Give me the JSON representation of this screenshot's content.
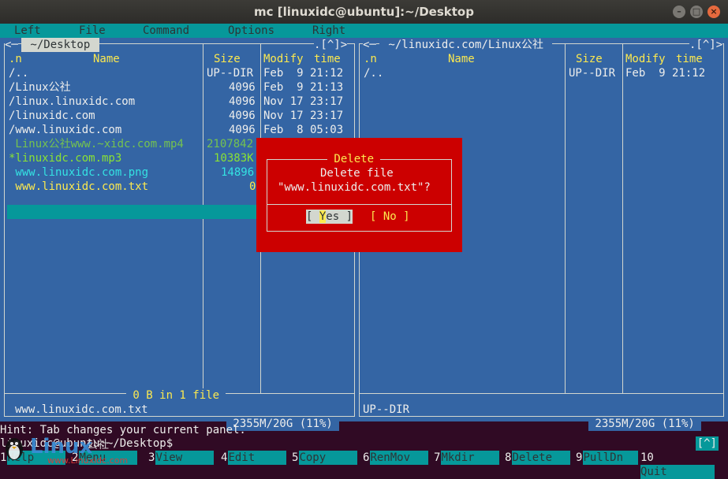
{
  "window": {
    "title": "mc [linuxidc@ubuntu]:~/Desktop"
  },
  "menu": {
    "left": "Left",
    "file": "File",
    "command": "Command",
    "options": "Options",
    "right": "Right"
  },
  "left_panel": {
    "path": " ~/Desktop ",
    "corner": ".[^]>",
    "cols": {
      "n": ".n",
      "name": "Name",
      "size": "Size",
      "modify": "Modify",
      "time": "time"
    },
    "rows": [
      {
        "name": "/..",
        "size": "UP--DIR",
        "date": "Feb  9 21:12"
      },
      {
        "name": "/Linux公社",
        "size": "4096",
        "date": "Feb  9 21:13"
      },
      {
        "name": "/linux.linuxidc.com",
        "size": "4096",
        "date": "Nov 17 23:17"
      },
      {
        "name": "/linuxidc.com",
        "size": "4096",
        "date": "Nov 17 23:17"
      },
      {
        "name": "/www.linuxidc.com",
        "size": "4096",
        "date": "Feb  8 05:03"
      },
      {
        "name": " Linux公社www.~xidc.com.mp4",
        "size": "2107842",
        "date": ""
      },
      {
        "name": "*linuxidc.com.mp3",
        "size": "10383K",
        "date": ""
      },
      {
        "name": " www.linuxidc.com.png",
        "size": "14896",
        "date": ""
      },
      {
        "name": " www.linuxidc.com.txt",
        "size": "0",
        "date": ""
      }
    ],
    "summary": " 0 B in 1 file ",
    "mini": "www.linuxidc.com.txt",
    "disk": " 2355M/20G (11%) "
  },
  "right_panel": {
    "path": " ~/linuxidc.com/Linux公社 ",
    "corner": ".[^]>",
    "cols": {
      "n": ".n",
      "name": "Name",
      "size": "Size",
      "modify": "Modify",
      "time": "time"
    },
    "rows": [
      {
        "name": "/..",
        "size": "UP--DIR",
        "date": "Feb  9 21:12"
      }
    ],
    "mini": "UP--DIR",
    "disk": " 2355M/20G (11%) "
  },
  "dialog": {
    "title": " Delete ",
    "line1": "Delete file",
    "line2": "\"www.linuxidc.com.txt\"?",
    "yes_open": "[ ",
    "yes_hot": "Y",
    "yes_rest": "es ]",
    "no": "[ No ]"
  },
  "hint": "Hint: Tab changes your current panel.",
  "prompt": "linuxidc@ubuntu:~/Desktop$",
  "corner_btn": "[^]",
  "fkeys": [
    {
      "n": "1",
      "label": "Help"
    },
    {
      "n": "2",
      "label": "Menu"
    },
    {
      "n": "3",
      "label": "View"
    },
    {
      "n": "4",
      "label": "Edit"
    },
    {
      "n": "5",
      "label": "Copy"
    },
    {
      "n": "6",
      "label": "RenMov"
    },
    {
      "n": "7",
      "label": "Mkdir"
    },
    {
      "n": "8",
      "label": "Delete"
    },
    {
      "n": "9",
      "label": "PullDn"
    },
    {
      "n": "10",
      "label": "Quit"
    }
  ],
  "watermark": {
    "brand": "Linux",
    "sub": "公社",
    "url": "www.Linuxidc.com"
  },
  "colors": {
    "panel": "#3465a4",
    "dialog": "#cc0000",
    "accent": "#06989a",
    "highlight": "#fce94f"
  }
}
